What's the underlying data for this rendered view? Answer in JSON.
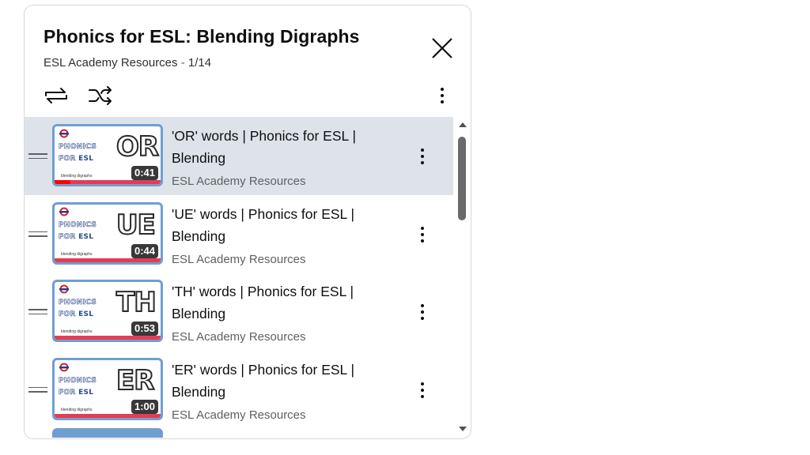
{
  "playlist": {
    "title": "Phonics for ESL: Blending Digraphs",
    "channel": "ESL Academy Resources",
    "separator": "-",
    "position": "1/14"
  },
  "controls": {
    "close_icon": "close-icon",
    "loop_icon": "loop-icon",
    "shuffle_icon": "shuffle-icon",
    "menu_icon": "more-vert-icon"
  },
  "thumb_text": {
    "phonics": "PHONICS",
    "for": "FOR",
    "esl": "ESL",
    "caption": "blending digraphs"
  },
  "items": [
    {
      "title": "'OR' words | Phonics for ESL | Blending",
      "channel": "ESL Academy Resources",
      "duration": "0:41",
      "digraph": "OR",
      "active": true,
      "watched_fraction": 0.15
    },
    {
      "title": "'UE' words | Phonics for ESL | Blending",
      "channel": "ESL Academy Resources",
      "duration": "0:44",
      "digraph": "UE",
      "active": false,
      "watched_fraction": 0
    },
    {
      "title": "'TH' words | Phonics for ESL | Blending",
      "channel": "ESL Academy Resources",
      "duration": "0:53",
      "digraph": "TH",
      "active": false,
      "watched_fraction": 0
    },
    {
      "title": "'ER' words | Phonics for ESL | Blending",
      "channel": "ESL Academy Resources",
      "duration": "1:00",
      "digraph": "ER",
      "active": false,
      "watched_fraction": 0
    }
  ],
  "colors": {
    "active_row": "#dee3ea",
    "thumb_border": "#6f9fd0",
    "thumb_bar": "#e63b55",
    "text_secondary": "#606060"
  }
}
